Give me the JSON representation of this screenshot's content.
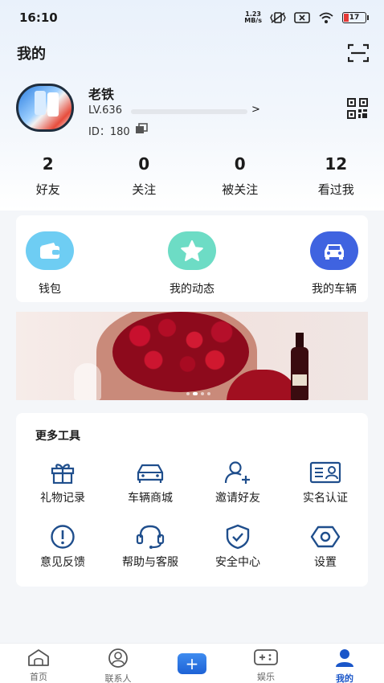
{
  "status_bar": {
    "time": "16:10",
    "net_speed_value": "1.23",
    "net_speed_unit": "MB/s",
    "battery": "17"
  },
  "header": {
    "title": "我的"
  },
  "profile": {
    "nickname": "老铁",
    "level": "LV.636",
    "level_arrow": ">",
    "user_id": "ID：180"
  },
  "stats": [
    {
      "value": "2",
      "label": "好友"
    },
    {
      "value": "0",
      "label": "关注"
    },
    {
      "value": "0",
      "label": "被关注"
    },
    {
      "value": "12",
      "label": "看过我"
    }
  ],
  "quick_actions": [
    {
      "label": "钱包",
      "icon": "wallet-icon",
      "color": "#6ecdf3"
    },
    {
      "label": "我的动态",
      "icon": "star-icon",
      "color": "#6ddcc5"
    },
    {
      "label": "我的车辆",
      "icon": "car-icon",
      "color": "#3f63e0"
    }
  ],
  "banner": {
    "slides": 4,
    "active_slide": 1
  },
  "tools": {
    "title": "更多工具",
    "items": [
      {
        "label": "礼物记录",
        "icon": "gift-icon"
      },
      {
        "label": "车辆商城",
        "icon": "car-mall-icon"
      },
      {
        "label": "邀请好友",
        "icon": "add-friend-icon"
      },
      {
        "label": "实名认证",
        "icon": "id-card-icon"
      },
      {
        "label": "意见反馈",
        "icon": "feedback-icon"
      },
      {
        "label": "帮助与客服",
        "icon": "headset-icon"
      },
      {
        "label": "安全中心",
        "icon": "shield-icon"
      },
      {
        "label": "设置",
        "icon": "settings-icon"
      }
    ]
  },
  "tabbar": {
    "items": [
      {
        "label": "首页",
        "icon": "home-icon"
      },
      {
        "label": "联系人",
        "icon": "contacts-icon"
      },
      {
        "label": "+",
        "icon": "add-icon"
      },
      {
        "label": "娱乐",
        "icon": "entertainment-icon"
      },
      {
        "label": "我的",
        "icon": "profile-icon",
        "active": true
      }
    ]
  },
  "colors": {
    "accent": "#1a56c9",
    "icon_blue": "#1f4e8c"
  }
}
